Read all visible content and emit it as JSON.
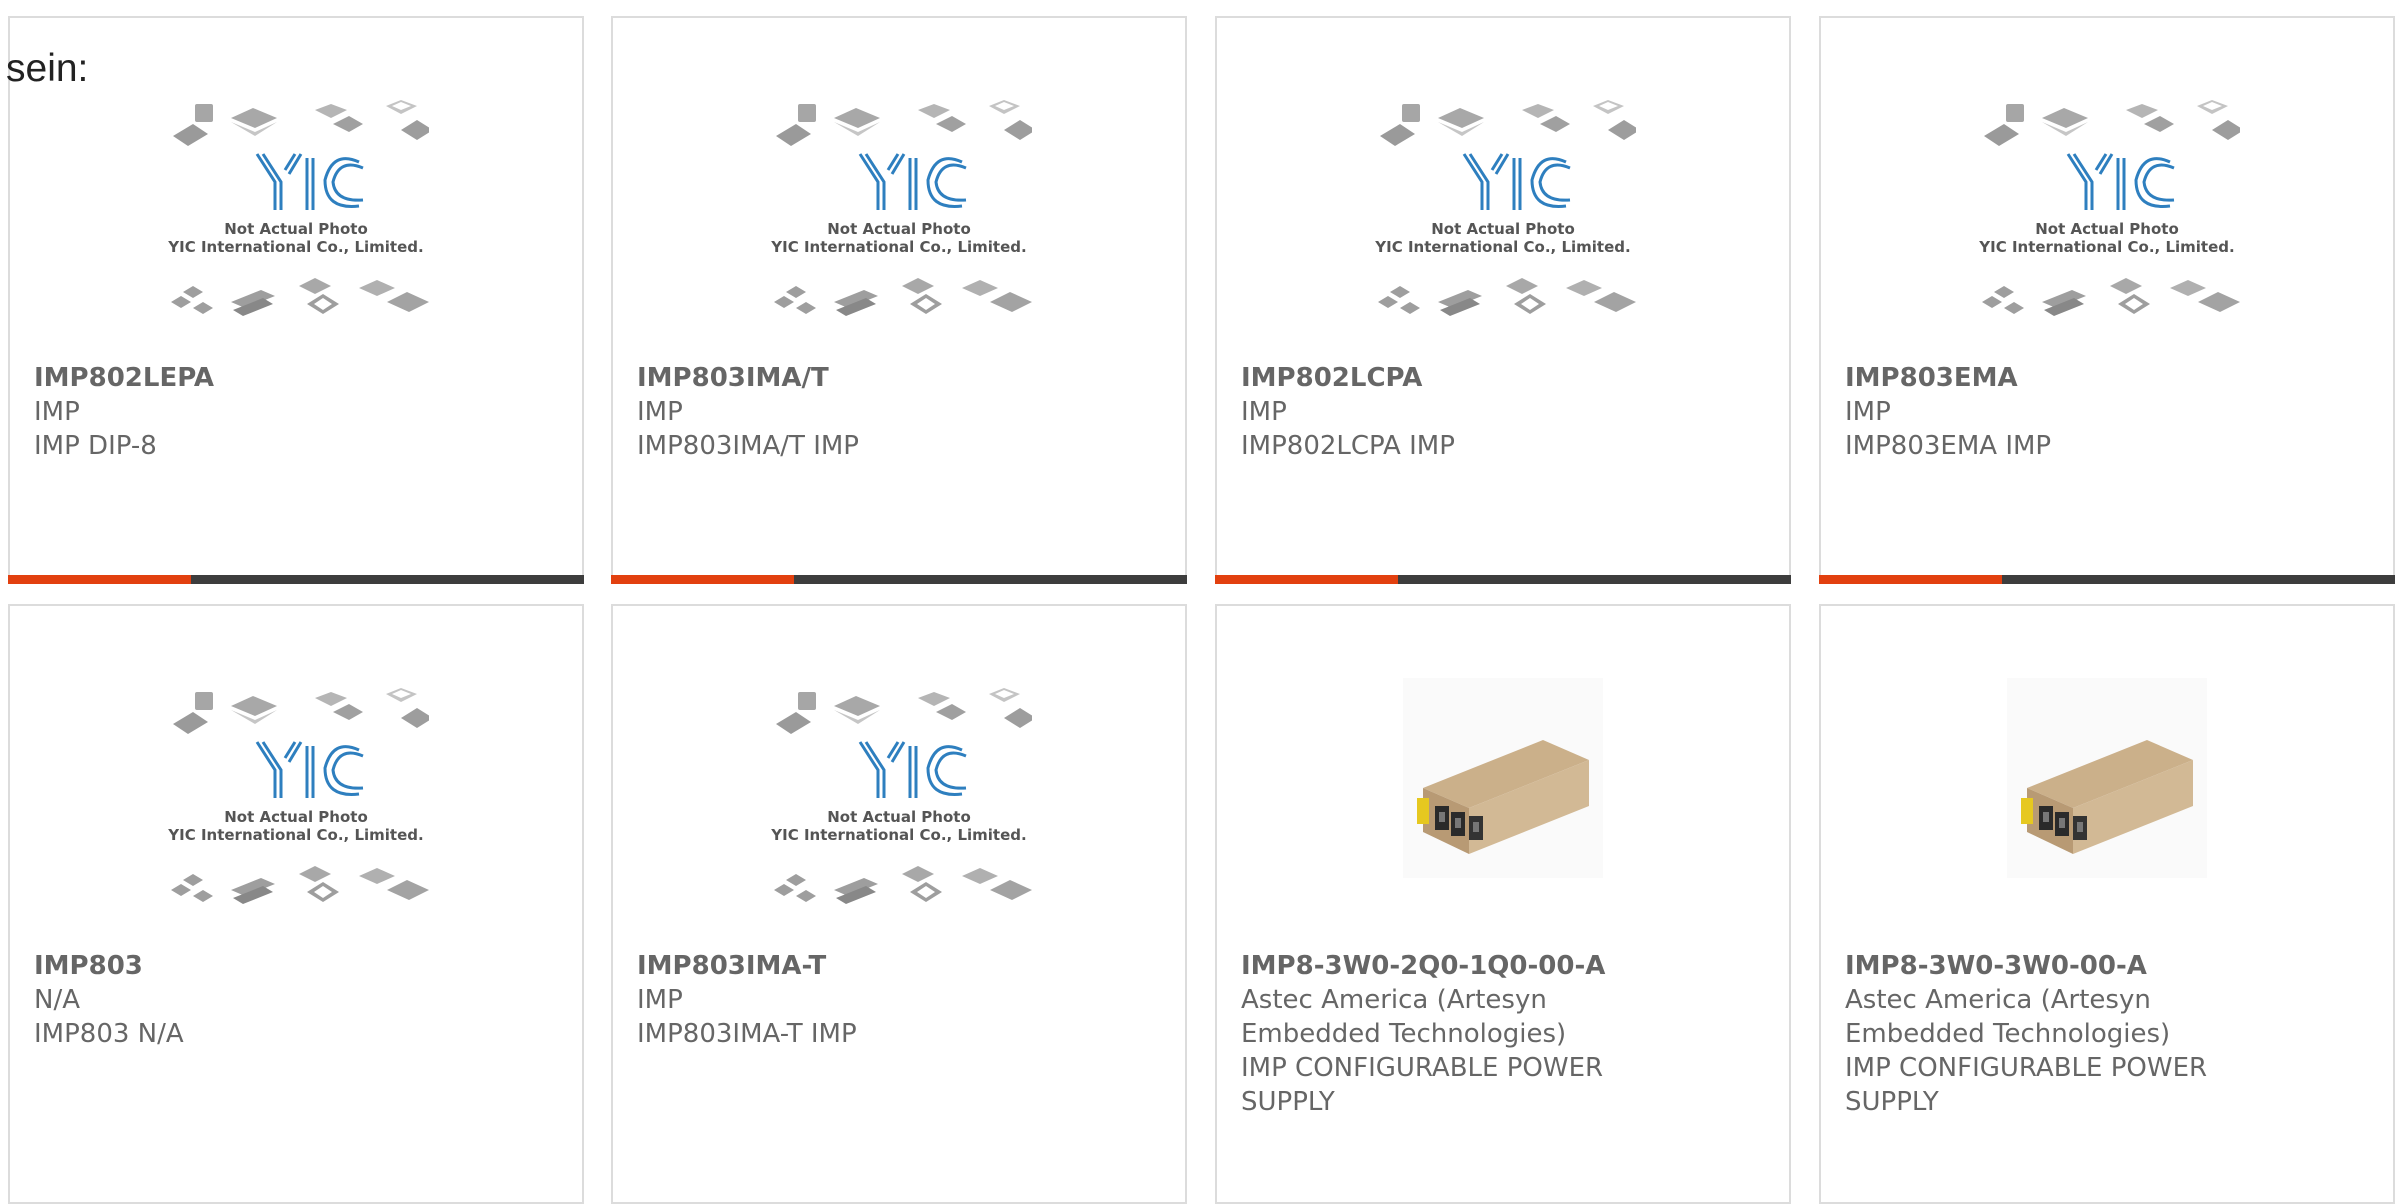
{
  "intro": {
    "text": "sein:"
  },
  "placeholder": {
    "line1": "Not Actual Photo",
    "line2": "YIC International Co., Limited.",
    "logo": "YIC",
    "accent_color": "#e2400f",
    "bar_color": "#3d3d3d",
    "logo_color": "#2e7fbf"
  },
  "products": [
    {
      "part_number": "IMP802LEPA",
      "manufacturer": "IMP",
      "description": "IMP DIP-8",
      "image": "yic-placeholder"
    },
    {
      "part_number": "IMP803IMA/T",
      "manufacturer": "IMP",
      "description": "IMP803IMA/T IMP",
      "image": "yic-placeholder"
    },
    {
      "part_number": "IMP802LCPA",
      "manufacturer": "IMP",
      "description": "IMP802LCPA IMP",
      "image": "yic-placeholder"
    },
    {
      "part_number": "IMP803EMA",
      "manufacturer": "IMP",
      "description": "IMP803EMA IMP",
      "image": "yic-placeholder"
    },
    {
      "part_number": "IMP803",
      "manufacturer": "N/A",
      "description": "IMP803 N/A",
      "image": "yic-placeholder"
    },
    {
      "part_number": "IMP803IMA-T",
      "manufacturer": "IMP",
      "description": "IMP803IMA-T IMP",
      "image": "yic-placeholder"
    },
    {
      "part_number": "IMP8-3W0-2Q0-1Q0-00-A",
      "manufacturer": "Astec America (Artesyn Embedded Technologies)",
      "description": "IMP CONFIGURABLE POWER SUPPLY",
      "image": "power-supply-photo"
    },
    {
      "part_number": "IMP8-3W0-3W0-00-A",
      "manufacturer": "Astec America (Artesyn Embedded Technologies)",
      "description": "IMP CONFIGURABLE POWER SUPPLY",
      "image": "power-supply-photo"
    }
  ]
}
